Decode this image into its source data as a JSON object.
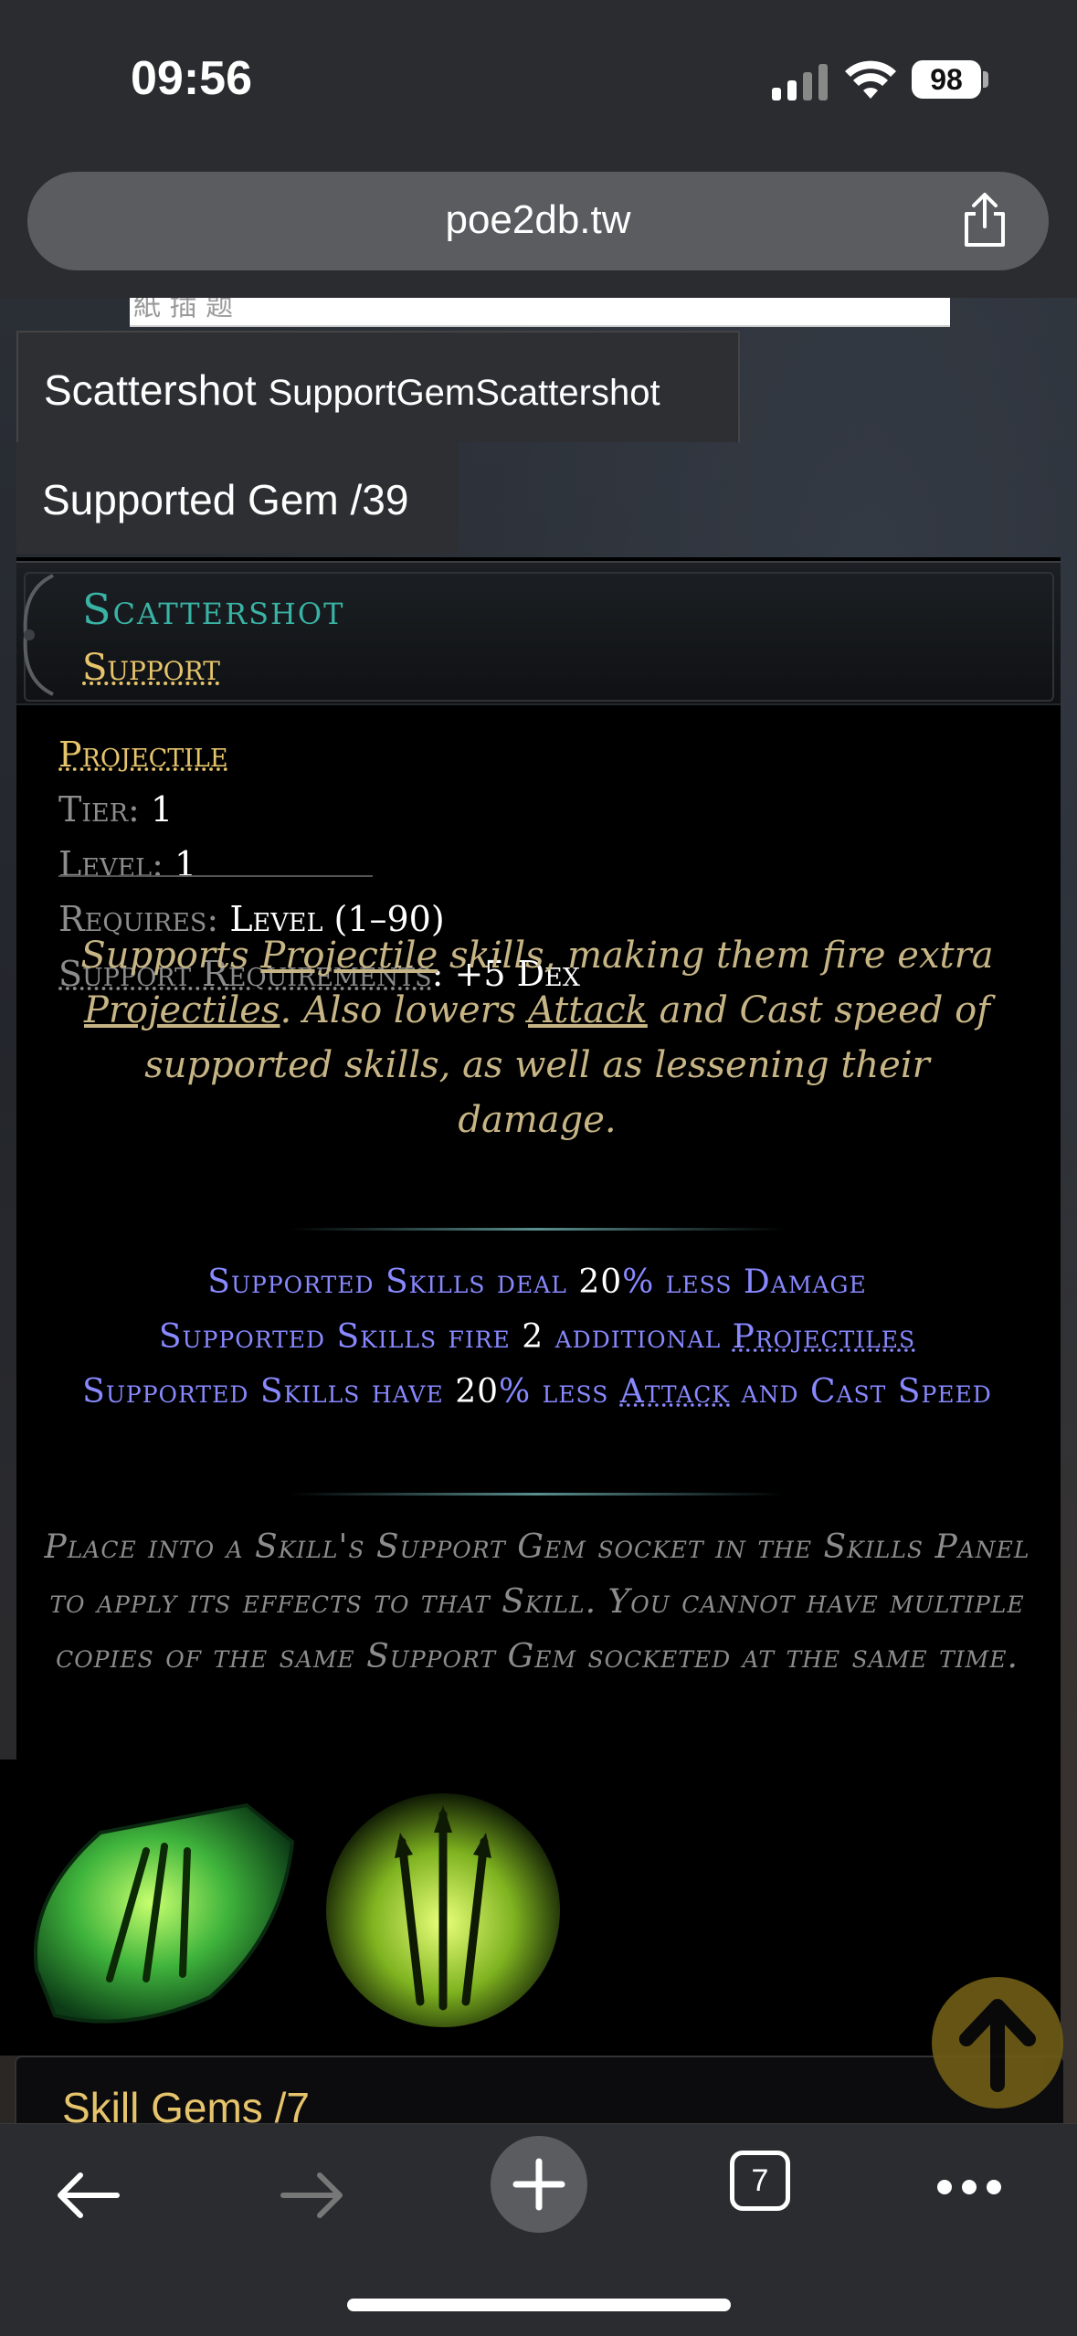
{
  "status_bar": {
    "time": "09:56",
    "battery": "98"
  },
  "browser": {
    "url": "poe2db.tw",
    "open_tabs": "7"
  },
  "search_strip": {
    "partial_text": "紙 插 题"
  },
  "tabs": {
    "item_tab_name": "Scattershot",
    "item_tab_id": "SupportGemScattershot",
    "supported_gem_tab": "Supported Gem /39"
  },
  "gem": {
    "name": "Scattershot",
    "type": "Support",
    "tag": "Projectile",
    "tier_label": "Tier:",
    "tier_value": "1",
    "level_label": "Level:",
    "level_value": "1",
    "requires_label": "Requires:",
    "requires_value": "Level (1–90)",
    "support_req_label": "Support Requirements",
    "support_req_value": ": +5 Dex",
    "description": {
      "p1": "Supports ",
      "l1": "Projectile",
      "p2": " skills, making them fire extra ",
      "l2": "Projectiles",
      "p3": ". Also lowers ",
      "l3": "Attack",
      "p4": " and Cast speed of supported skills, as well as lessening their damage."
    },
    "mods": {
      "m1_pre": "Supported Skills deal ",
      "m1_val": "20",
      "m1_post": "% less Damage",
      "m2_pre": "Supported Skills fire ",
      "m2_val": "2",
      "m2_mid": " additional ",
      "m2_link": "Projectiles",
      "m3_pre": "Supported Skills have ",
      "m3_val": "20",
      "m3_mid": "% less ",
      "m3_link": "Attack",
      "m3_post": " and Cast Speed"
    },
    "help_text": "Place into a Skill's Support Gem socket in the Skills Panel to apply its effects to that Skill. You cannot have multiple copies of the same Support Gem socketed at the same time."
  },
  "next_section": {
    "title": "Skill Gems /7"
  },
  "colors": {
    "gem_name": "#39b3a4",
    "gold": "#e6c46b",
    "mod_blue": "#8888ff",
    "flavor": "#c7b585"
  },
  "icons": [
    "signal-icon",
    "wifi-icon",
    "share-icon",
    "back-arrow-icon",
    "forward-arrow-icon",
    "plus-icon",
    "tabs-icon",
    "more-icon",
    "scroll-top-arrow-icon"
  ]
}
